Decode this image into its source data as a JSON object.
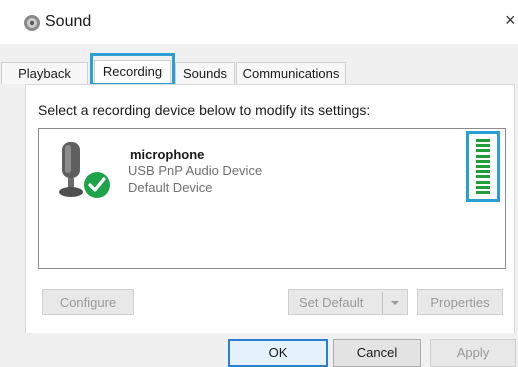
{
  "window": {
    "title": "Sound",
    "close_glyph": "×"
  },
  "tabs": [
    {
      "label": "Playback"
    },
    {
      "label": "Recording",
      "selected": true
    },
    {
      "label": "Sounds"
    },
    {
      "label": "Communications"
    }
  ],
  "instruction": "Select a recording device below to modify its settings:",
  "device": {
    "name": "microphone",
    "description": "USB PnP Audio Device",
    "status": "Default Device",
    "icon": "microphone-icon",
    "badge": "green-check-icon",
    "level_meter_fraction": 1.0
  },
  "buttons": {
    "configure": "Configure",
    "set_default": "Set Default",
    "properties": "Properties",
    "ok": "OK",
    "cancel": "Cancel",
    "apply": "Apply"
  },
  "colors": {
    "accent": "#2a9fd6",
    "meter": "#1f9e3a",
    "check": "#1fa34a"
  }
}
